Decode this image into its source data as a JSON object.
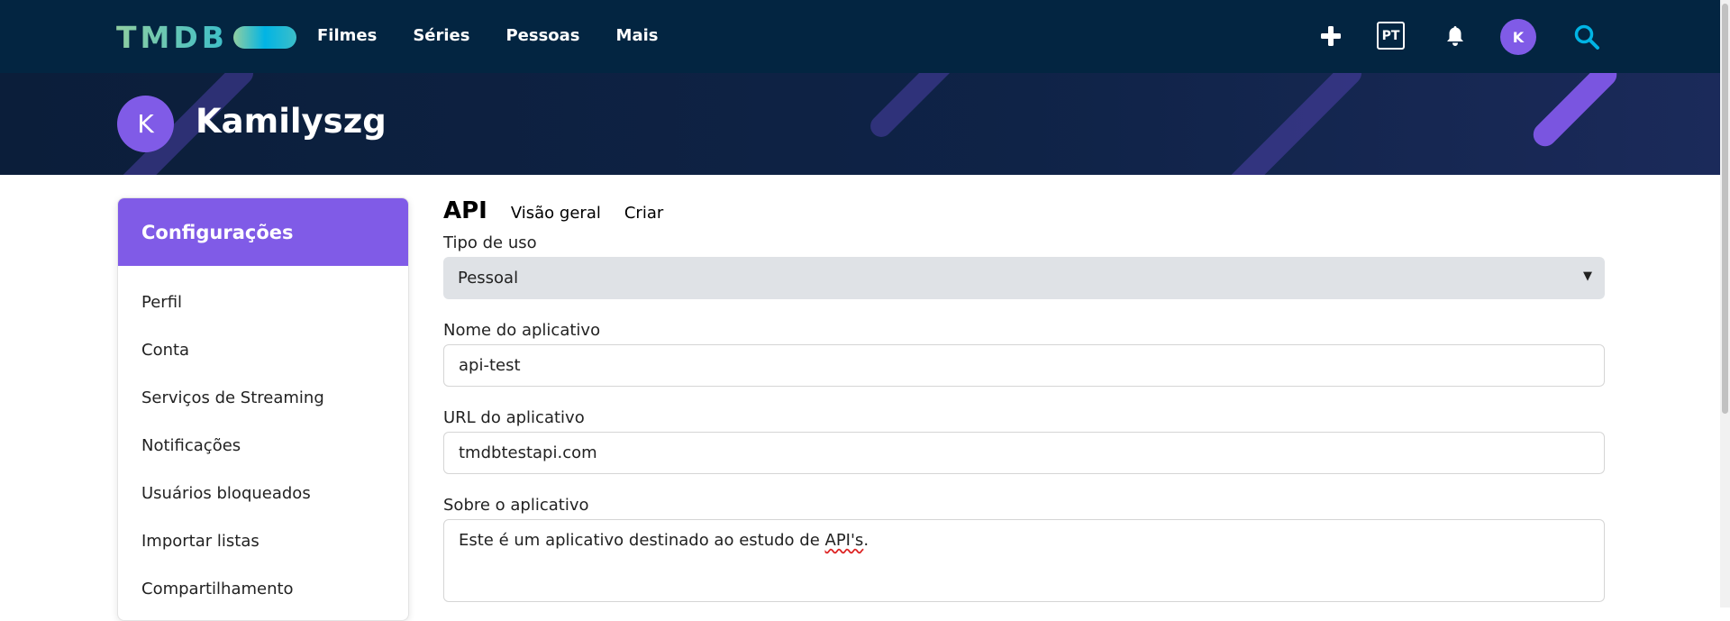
{
  "nav": {
    "logo": "TMDB",
    "menu": [
      "Filmes",
      "Séries",
      "Pessoas",
      "Mais"
    ],
    "lang": "PT",
    "avatar_initial": "K",
    "colors": {
      "bg": "#032541",
      "accent": "#01b4e4",
      "avatar": "#805be7"
    }
  },
  "profile": {
    "avatar_initial": "K",
    "username": "Kamilyszg"
  },
  "sidebar": {
    "title": "Configurações",
    "items": [
      "Perfil",
      "Conta",
      "Serviços de Streaming",
      "Notificações",
      "Usuários bloqueados",
      "Importar listas",
      "Compartilhamento"
    ]
  },
  "main": {
    "section_title": "API",
    "tabs": [
      "Visão geral",
      "Criar"
    ],
    "fields": {
      "usage_type": {
        "label": "Tipo de uso",
        "value": "Pessoal"
      },
      "app_name": {
        "label": "Nome do aplicativo",
        "value": "api-test"
      },
      "app_url": {
        "label": "URL do aplicativo",
        "value": "tmdbtestapi.com"
      },
      "app_about": {
        "label": "Sobre o aplicativo",
        "value_before": "Este é um aplicativo destinado ao estudo de ",
        "value_flagged": "API's",
        "value_after": "."
      }
    }
  }
}
